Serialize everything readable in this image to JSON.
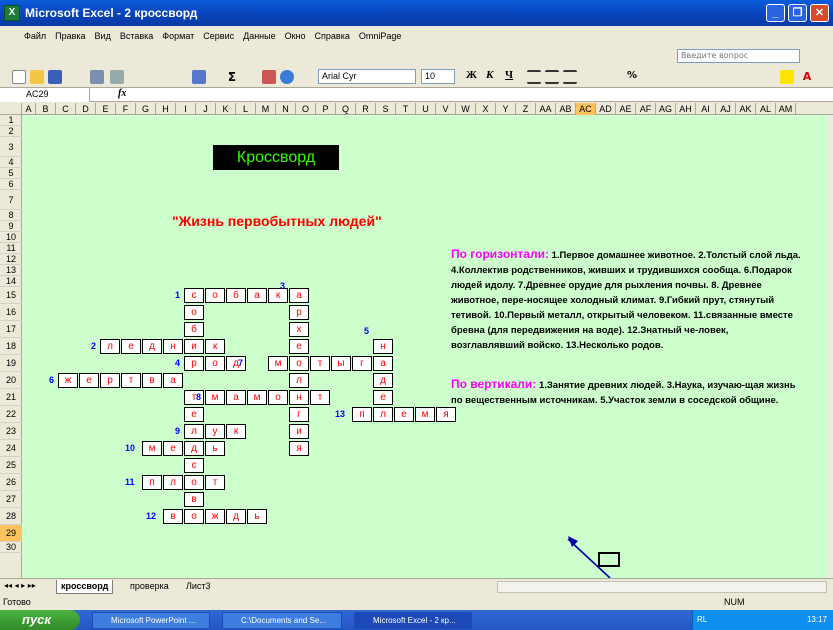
{
  "window": {
    "title": "Microsoft Excel - 2 кроссворд",
    "app_icon": "X"
  },
  "menu": [
    "Файл",
    "Правка",
    "Вид",
    "Вставка",
    "Формат",
    "Сервис",
    "Данные",
    "Окно",
    "Справка",
    "OmniPage"
  ],
  "ask_placeholder": "Введите вопрос",
  "font": {
    "name": "Arial Cyr",
    "size": "10"
  },
  "formula_bar": {
    "name_box": "AC29",
    "fx": "fx"
  },
  "columns": [
    "A",
    "B",
    "C",
    "D",
    "E",
    "F",
    "G",
    "H",
    "I",
    "J",
    "K",
    "L",
    "M",
    "N",
    "O",
    "P",
    "Q",
    "R",
    "S",
    "T",
    "U",
    "V",
    "W",
    "X",
    "Y",
    "Z",
    "AA",
    "AB",
    "AC",
    "AD",
    "AE",
    "AF",
    "AG",
    "AH",
    "AI",
    "AJ",
    "AK",
    "AL",
    "AM"
  ],
  "selected_column": "AC",
  "rows": [
    "1",
    "2",
    "3",
    "4",
    "5",
    "6",
    "7",
    "8",
    "9",
    "10",
    "11",
    "12",
    "13",
    "14",
    "15",
    "16",
    "17",
    "18",
    "19",
    "20",
    "21",
    "22",
    "23",
    "24",
    "25",
    "26",
    "27",
    "28",
    "29",
    "30"
  ],
  "selected_row": "29",
  "sheet": {
    "title": "Кроссворд",
    "subtitle": "\"Жизнь первобытных людей\"",
    "horizontal_head": "По горизонтали:",
    "horizontal_text": "1.Первое домашнее животное. 2.Толстый слой льда. 4.Коллектив родственников, живших и трудившихся сообща. 6.Подарок людей идолу. 7.Древнее орудие для рыхления почвы. 8. Древнее животное, пере-носящее холодный климат. 9.Гибкий прут, стянутый тетивой. 10.Первый металл, открытый человеком. 11.связанные вместе бревна (для передвижения на воде). 12.Знатный че-ловек, возглавлявший войско. 13.Несколько родов.",
    "vertical_head": "По вертикали:",
    "vertical_text": "1.Занятие древних людей. 3.Наука, изучаю-щая жизнь по вещественным источникам. 5.Участок земли в соседской общине."
  },
  "crossword": {
    "numbers": [
      {
        "n": "1",
        "r": 15,
        "c": 7
      },
      {
        "n": "3",
        "r": 14,
        "c": 12
      },
      {
        "n": "5",
        "r": 17,
        "c": 16
      },
      {
        "n": "2",
        "r": 18,
        "c": 3
      },
      {
        "n": "4",
        "r": 19,
        "c": 7
      },
      {
        "n": "7",
        "r": 19,
        "c": 10
      },
      {
        "n": "6",
        "r": 20,
        "c": 1
      },
      {
        "n": "8",
        "r": 21,
        "c": 8
      },
      {
        "n": "13",
        "r": 22,
        "c": 15
      },
      {
        "n": "9",
        "r": 23,
        "c": 7
      },
      {
        "n": "10",
        "r": 24,
        "c": 5
      },
      {
        "n": "11",
        "r": 26,
        "c": 5
      },
      {
        "n": "12",
        "r": 28,
        "c": 6
      }
    ],
    "cells": [
      {
        "r": 15,
        "c": 8,
        "t": "с"
      },
      {
        "r": 15,
        "c": 9,
        "t": "о"
      },
      {
        "r": 15,
        "c": 10,
        "t": "б"
      },
      {
        "r": 15,
        "c": 11,
        "t": "а"
      },
      {
        "r": 15,
        "c": 12,
        "t": "к"
      },
      {
        "r": 15,
        "c": 13,
        "t": "а"
      },
      {
        "r": 16,
        "c": 8,
        "t": "о"
      },
      {
        "r": 16,
        "c": 13,
        "t": "р"
      },
      {
        "r": 17,
        "c": 8,
        "t": "б"
      },
      {
        "r": 17,
        "c": 13,
        "t": "х"
      },
      {
        "r": 18,
        "c": 4,
        "t": "л"
      },
      {
        "r": 18,
        "c": 5,
        "t": "е"
      },
      {
        "r": 18,
        "c": 6,
        "t": "д"
      },
      {
        "r": 18,
        "c": 7,
        "t": "н"
      },
      {
        "r": 18,
        "c": 8,
        "t": "и"
      },
      {
        "r": 18,
        "c": 9,
        "t": "к"
      },
      {
        "r": 18,
        "c": 13,
        "t": "е"
      },
      {
        "r": 18,
        "c": 17,
        "t": "н"
      },
      {
        "r": 19,
        "c": 8,
        "t": "р"
      },
      {
        "r": 19,
        "c": 9,
        "t": "о"
      },
      {
        "r": 19,
        "c": 10,
        "t": "д"
      },
      {
        "r": 19,
        "c": 12,
        "t": "м"
      },
      {
        "r": 19,
        "c": 13,
        "t": "о"
      },
      {
        "r": 19,
        "c": 14,
        "t": "т"
      },
      {
        "r": 19,
        "c": 15,
        "t": "ы"
      },
      {
        "r": 19,
        "c": 16,
        "t": "г"
      },
      {
        "r": 19,
        "c": 17,
        "t": "а"
      },
      {
        "r": 20,
        "c": 2,
        "t": "ж"
      },
      {
        "r": 20,
        "c": 3,
        "t": "е"
      },
      {
        "r": 20,
        "c": 4,
        "t": "р"
      },
      {
        "r": 20,
        "c": 5,
        "t": "т"
      },
      {
        "r": 20,
        "c": 6,
        "t": "в"
      },
      {
        "r": 20,
        "c": 7,
        "t": "а"
      },
      {
        "r": 20,
        "c": 13,
        "t": "л"
      },
      {
        "r": 20,
        "c": 17,
        "t": "д"
      },
      {
        "r": 21,
        "c": 8,
        "t": "т"
      },
      {
        "r": 21,
        "c": 9,
        "t": "м"
      },
      {
        "r": 21,
        "c": 10,
        "t": "а"
      },
      {
        "r": 21,
        "c": 11,
        "t": "м"
      },
      {
        "r": 21,
        "c": 12,
        "t": "о"
      },
      {
        "r": 21,
        "c": 13,
        "t": "н"
      },
      {
        "r": 21,
        "c": 14,
        "t": "т"
      },
      {
        "r": 21,
        "c": 17,
        "t": "е"
      },
      {
        "r": 22,
        "c": 8,
        "t": "е"
      },
      {
        "r": 22,
        "c": 13,
        "t": "г"
      },
      {
        "r": 22,
        "c": 16,
        "t": "п"
      },
      {
        "r": 22,
        "c": 17,
        "t": "л"
      },
      {
        "r": 22,
        "c": 18,
        "t": "е"
      },
      {
        "r": 22,
        "c": 19,
        "t": "м"
      },
      {
        "r": 22,
        "c": 20,
        "t": "я"
      },
      {
        "r": 23,
        "c": 8,
        "t": "л"
      },
      {
        "r": 23,
        "c": 9,
        "t": "у"
      },
      {
        "r": 23,
        "c": 10,
        "t": "к"
      },
      {
        "r": 23,
        "c": 13,
        "t": "и"
      },
      {
        "r": 24,
        "c": 6,
        "t": "м"
      },
      {
        "r": 24,
        "c": 7,
        "t": "е"
      },
      {
        "r": 24,
        "c": 8,
        "t": "д"
      },
      {
        "r": 24,
        "c": 9,
        "t": "ь"
      },
      {
        "r": 24,
        "c": 13,
        "t": "я"
      },
      {
        "r": 25,
        "c": 8,
        "t": "с"
      },
      {
        "r": 26,
        "c": 6,
        "t": "п"
      },
      {
        "r": 26,
        "c": 7,
        "t": "л"
      },
      {
        "r": 26,
        "c": 8,
        "t": "о"
      },
      {
        "r": 26,
        "c": 9,
        "t": "т"
      },
      {
        "r": 27,
        "c": 8,
        "t": "в"
      },
      {
        "r": 28,
        "c": 7,
        "t": "в"
      },
      {
        "r": 28,
        "c": 8,
        "t": "о"
      },
      {
        "r": 28,
        "c": 9,
        "t": "ж"
      },
      {
        "r": 28,
        "c": 10,
        "t": "д"
      },
      {
        "r": 28,
        "c": 11,
        "t": "ь"
      }
    ]
  },
  "tabs": [
    "кроссворд",
    "проверка",
    "Лист3"
  ],
  "status": {
    "left": "Готово",
    "num": "NUM"
  },
  "taskbar": {
    "start": "пуск",
    "items": [
      "Microsoft PowerPoint ...",
      "C:\\Documents and Se...",
      "Microsoft Excel - 2 кр..."
    ],
    "tray_lang": "RL",
    "clock": "13:17"
  }
}
